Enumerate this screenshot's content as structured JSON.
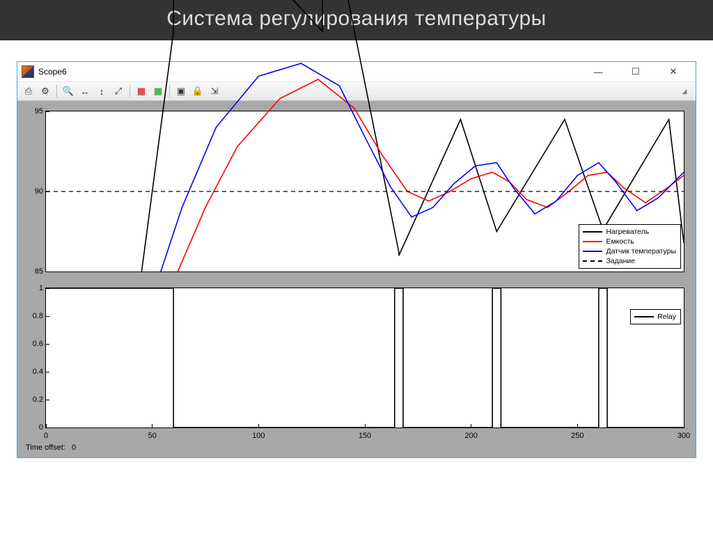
{
  "slide_title": "Система регулирования температуры",
  "window": {
    "title": "Scope6",
    "minimize": "—",
    "maximize": "☐",
    "close": "✕"
  },
  "toolbar": {
    "print": "⎙",
    "settings": "⚙",
    "zoom_in": "🔍",
    "zoom_xaxis": "↔",
    "zoom_yaxis": "↕",
    "autoscale": "⤢",
    "cursor1": "▦",
    "cursor2": "▦",
    "float": "▣",
    "lock": "🔒",
    "params": "⇲"
  },
  "time_offset_label": "Time offset:",
  "time_offset_value": "0",
  "chart_data": [
    {
      "type": "line",
      "xlim": [
        0,
        300
      ],
      "ylim": [
        85,
        95
      ],
      "yticks": [
        85,
        90,
        95
      ],
      "series": [
        {
          "name": "Нагреватель",
          "color": "#000000",
          "x": [
            45,
            60,
            60,
            130,
            130,
            166,
            166,
            195,
            195,
            212,
            212,
            244,
            244,
            262,
            262,
            293,
            293,
            300
          ],
          "y": [
            85,
            100,
            110,
            100,
            110,
            86.2,
            86,
            94.5,
            94.5,
            87.5,
            87.5,
            94.5,
            94.5,
            87.6,
            87.6,
            94.5,
            94.5,
            86.8
          ]
        },
        {
          "name": "Емкость",
          "color": "#ff0000",
          "x": [
            62,
            75,
            90,
            110,
            128,
            145,
            158,
            170,
            180,
            190,
            200,
            210,
            218,
            226,
            236,
            246,
            255,
            264,
            272,
            282,
            292,
            300
          ],
          "y": [
            85,
            89,
            92.8,
            95.8,
            97,
            95.2,
            92.3,
            90.0,
            89.4,
            90.0,
            90.8,
            91.2,
            90.6,
            89.5,
            89.0,
            90.0,
            91.0,
            91.2,
            90.2,
            89.3,
            90.2,
            91.0
          ]
        },
        {
          "name": "Датчик температуры",
          "color": "#0000ff",
          "x": [
            54,
            64,
            80,
            100,
            120,
            138,
            150,
            162,
            172,
            182,
            192,
            202,
            212,
            220,
            230,
            240,
            250,
            260,
            268,
            278,
            288,
            300
          ],
          "y": [
            85,
            89,
            94,
            97.2,
            98,
            96.6,
            93.4,
            90.3,
            88.4,
            89.0,
            90.5,
            91.6,
            91.8,
            90.2,
            88.6,
            89.4,
            91.0,
            91.8,
            90.6,
            88.8,
            89.6,
            91.2
          ]
        },
        {
          "name": "Задание",
          "color": "#000000",
          "dashed": true,
          "x": [
            0,
            300
          ],
          "y": [
            90,
            90
          ]
        }
      ],
      "legend_position": "bottom-right"
    },
    {
      "type": "line",
      "xlim": [
        0,
        300
      ],
      "ylim": [
        0,
        1
      ],
      "yticks": [
        0,
        0.2,
        0.4,
        0.6,
        0.8,
        1
      ],
      "xticks": [
        0,
        50,
        100,
        150,
        200,
        250,
        300
      ],
      "series": [
        {
          "name": "Relay",
          "color": "#000000",
          "x": [
            0,
            60,
            60,
            164,
            164,
            168,
            168,
            210,
            210,
            214,
            214,
            260,
            260,
            264,
            264,
            300
          ],
          "y": [
            1,
            1,
            0,
            0,
            1,
            1,
            0,
            0,
            1,
            1,
            0,
            0,
            1,
            1,
            0,
            0
          ]
        }
      ],
      "legend_position": "top-right"
    }
  ]
}
